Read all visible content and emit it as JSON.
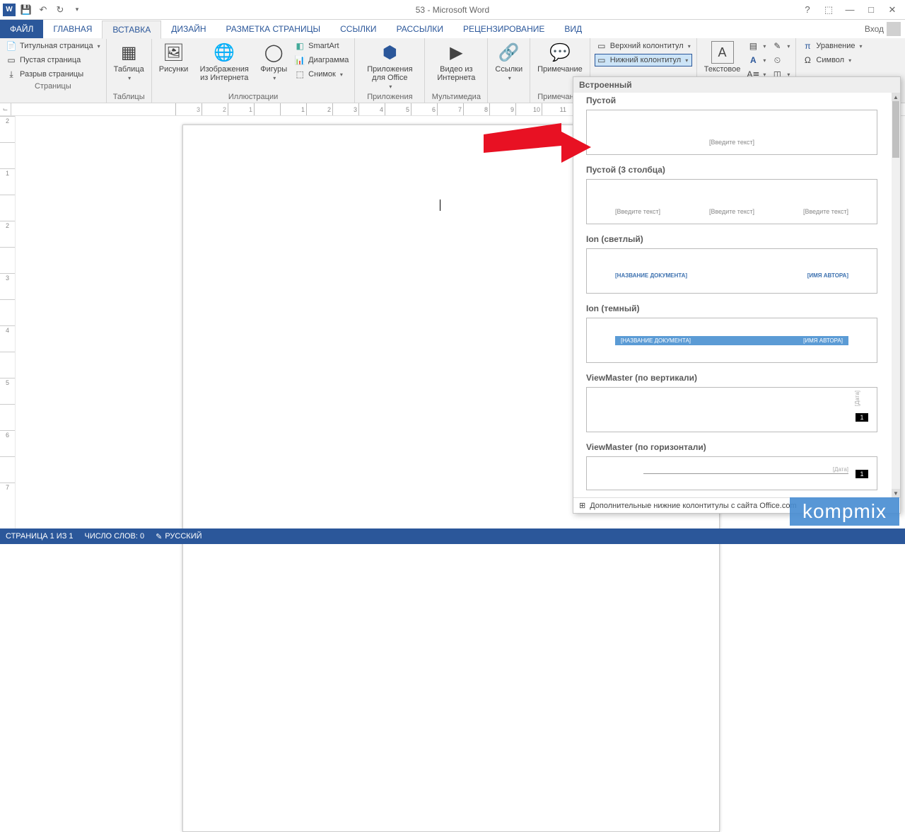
{
  "titlebar": {
    "title": "53 - Microsoft Word"
  },
  "tabs": {
    "file": "ФАЙЛ",
    "items": [
      "ГЛАВНАЯ",
      "ВСТАВКА",
      "ДИЗАЙН",
      "РАЗМЕТКА СТРАНИЦЫ",
      "ССЫЛКИ",
      "РАССЫЛКИ",
      "РЕЦЕНЗИРОВАНИЕ",
      "ВИД"
    ],
    "active_index": 1,
    "signin": "Вход"
  },
  "ribbon": {
    "pages": {
      "cover": "Титульная страница",
      "blank": "Пустая страница",
      "break": "Разрыв страницы",
      "label": "Страницы"
    },
    "tables": {
      "btn": "Таблица",
      "label": "Таблицы"
    },
    "illus": {
      "pics": "Рисунки",
      "online": "Изображения из Интернета",
      "shapes": "Фигуры",
      "smartart": "SmartArt",
      "chart": "Диаграмма",
      "screenshot": "Снимок",
      "label": "Иллюстрации"
    },
    "apps": {
      "btn": "Приложения для Office",
      "label": "Приложения"
    },
    "media": {
      "btn": "Видео из Интернета",
      "label": "Мультимедиа"
    },
    "links": {
      "btn": "Ссылки"
    },
    "comments": {
      "btn": "Примечание",
      "label": "Примечания"
    },
    "header": {
      "top": "Верхний колонтитул",
      "bottom": "Нижний колонтитул"
    },
    "text": {
      "textbox": "Текстовое"
    },
    "symbols": {
      "eq": "Уравнение",
      "sym": "Символ"
    }
  },
  "gallery": {
    "heading": "Встроенный",
    "items": [
      {
        "label": "Пустой",
        "type": "single",
        "text": "[Введите текст]"
      },
      {
        "label": "Пустой (3 столбца)",
        "type": "three",
        "text": "[Введите текст]"
      },
      {
        "label": "Ion (светлый)",
        "type": "ion_light",
        "doc": "[НАЗВАНИЕ ДОКУМЕНТА]",
        "auth": "[ИМЯ АВТОРА]"
      },
      {
        "label": "Ion (темный)",
        "type": "ion_dark",
        "doc": "[НАЗВАНИЕ ДОКУМЕНТА]",
        "auth": "[ИМЯ АВТОРА]"
      },
      {
        "label": "ViewMaster (по вертикали)",
        "type": "vm_v",
        "date": "[Дата]",
        "page": "1"
      },
      {
        "label": "ViewMaster (по горизонтали)",
        "type": "vm_h",
        "date": "[Дата]",
        "page": "1"
      }
    ],
    "more": "Дополнительные нижние колонтитулы с сайта Office.com"
  },
  "ruler_h": [
    3,
    2,
    1,
    "",
    1,
    2,
    3,
    4,
    5,
    6,
    7,
    8,
    9,
    10,
    11
  ],
  "ruler_v": [
    2,
    "",
    1,
    "",
    2,
    "",
    3,
    "",
    4,
    "",
    5,
    "",
    6,
    "",
    7
  ],
  "status": {
    "page": "СТРАНИЦА 1 ИЗ 1",
    "words": "ЧИСЛО СЛОВ: 0",
    "lang": "РУССКИЙ"
  },
  "watermark": "kompmix"
}
